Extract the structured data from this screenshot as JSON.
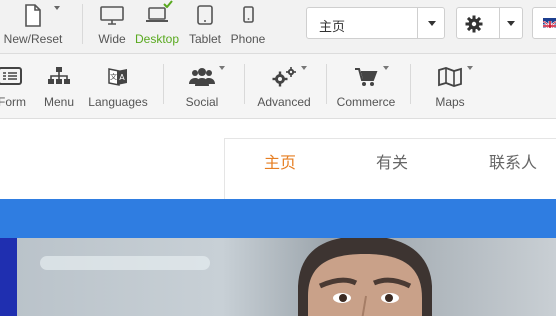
{
  "toolbar": {
    "new_reset": "New/Reset",
    "views": [
      {
        "label": "Wide",
        "icon": "monitor-icon"
      },
      {
        "label": "Desktop",
        "icon": "laptop-icon"
      },
      {
        "label": "Tablet",
        "icon": "tablet-icon"
      },
      {
        "label": "Phone",
        "icon": "phone-icon"
      }
    ],
    "page_select_value": "主页",
    "active_color": "#59a91f"
  },
  "toolbar2": {
    "items": [
      {
        "label": "Form",
        "icon": "form-icon"
      },
      {
        "label": "Menu",
        "icon": "sitemap-icon"
      },
      {
        "label": "Languages",
        "icon": "translate-icon"
      },
      {
        "label": "Social",
        "icon": "users-icon"
      },
      {
        "label": "Advanced",
        "icon": "gears-icon"
      },
      {
        "label": "Commerce",
        "icon": "cart-icon"
      },
      {
        "label": "Maps",
        "icon": "map-icon"
      }
    ]
  },
  "site": {
    "nav": [
      "主页",
      "有关",
      "联系人"
    ],
    "accent_color": "#e67e22",
    "band_color": "#2f7de1"
  }
}
